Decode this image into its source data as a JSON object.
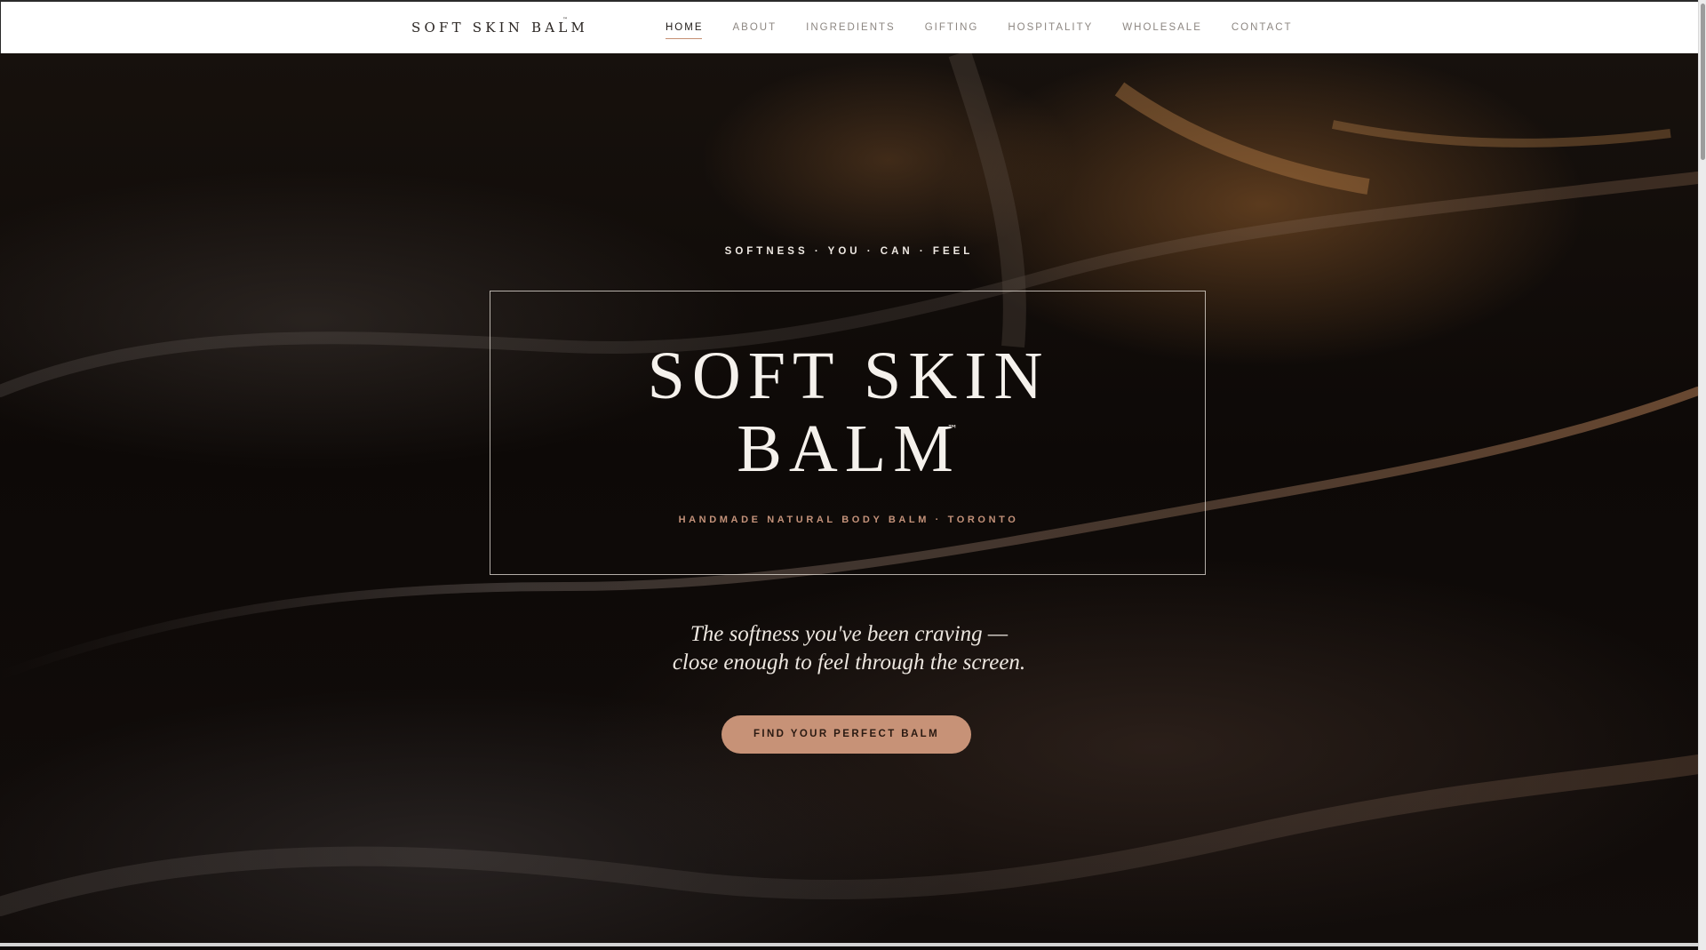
{
  "header": {
    "brand": "SOFT SKIN BALM",
    "brand_tm": "™",
    "nav": [
      {
        "label": "HOME",
        "active": true
      },
      {
        "label": "ABOUT",
        "active": false
      },
      {
        "label": "INGREDIENTS",
        "active": false
      },
      {
        "label": "GIFTING",
        "active": false
      },
      {
        "label": "HOSPITALITY",
        "active": false
      },
      {
        "label": "WHOLESALE",
        "active": false
      },
      {
        "label": "CONTACT",
        "active": false
      }
    ]
  },
  "hero": {
    "kicker": "SOFTNESS · YOU · CAN · FEEL",
    "title_line1": "SOFT SKIN",
    "title_line2": "BALM",
    "title_tm": "™",
    "subline": "HANDMADE NATURAL BODY BALM · TORONTO",
    "tagline_line1": "The softness you've been craving —",
    "tagline_line2": "close enough to feel through the screen.",
    "cta_label": "FIND YOUR PERFECT BALM",
    "background_image": "dark velvet fabric with warm amber highlights"
  },
  "colors": {
    "nav_active_underline": "#c48f72",
    "accent_copper": "#c4927a",
    "cta_background": "#c79277",
    "hero_background": "#0d0907"
  }
}
